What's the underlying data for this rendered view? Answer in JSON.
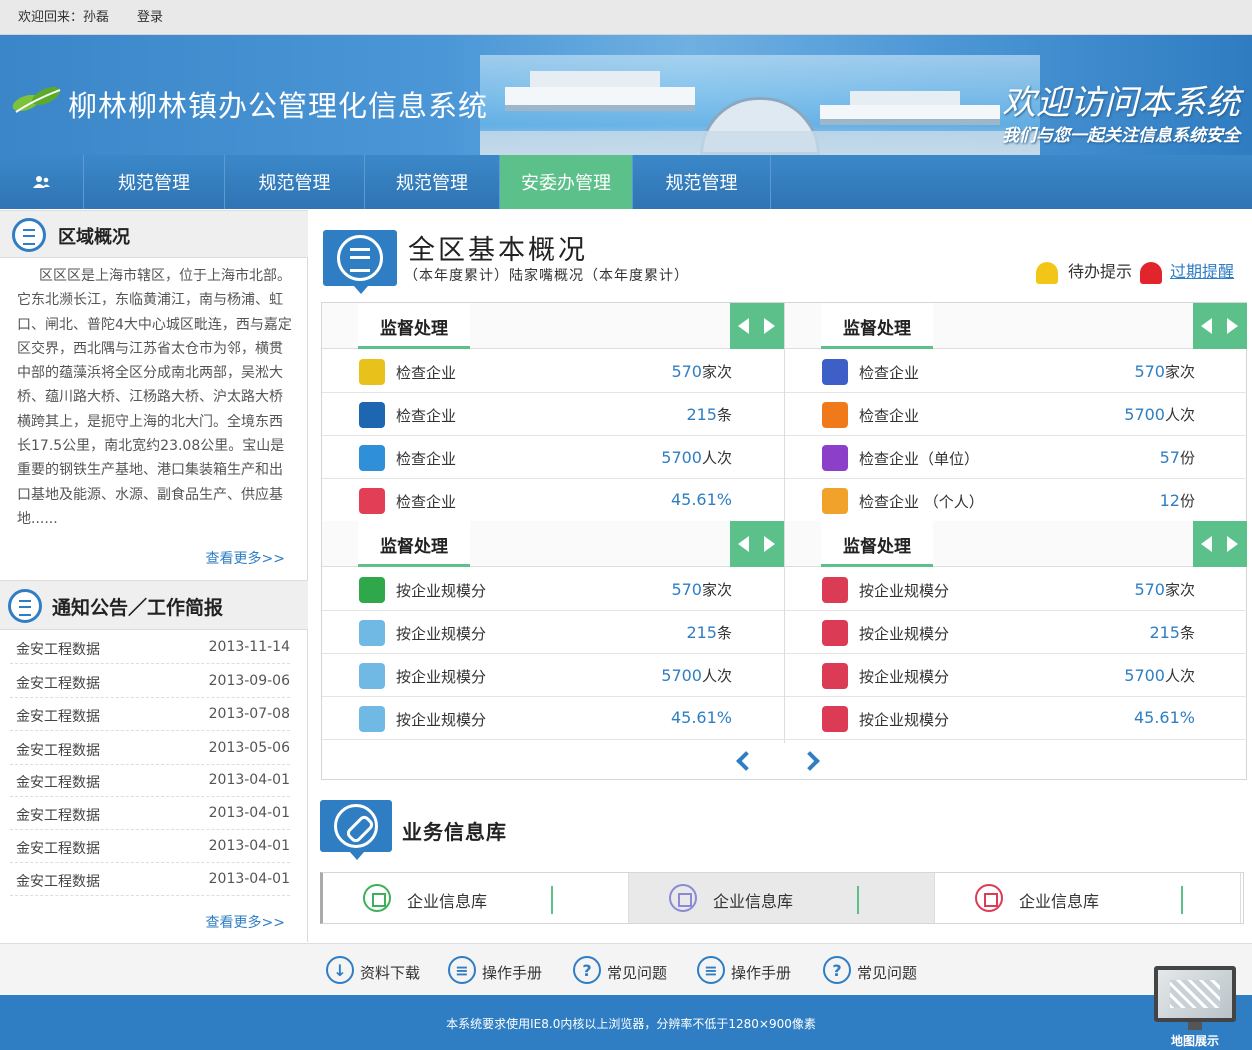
{
  "topbar": {
    "welcome": "欢迎回来：孙磊",
    "login": "登录"
  },
  "header": {
    "title": "柳林柳林镇办公管理化信息系统",
    "slogan": "欢迎访问本系统",
    "slogan_sub": "我们与您一起关注信息系统安全"
  },
  "nav": {
    "home_icon": "users-icon",
    "items": [
      {
        "label": "规范管理",
        "active": false
      },
      {
        "label": "规范管理",
        "active": false
      },
      {
        "label": "规范管理",
        "active": false
      },
      {
        "label": "安委办管理",
        "active": true
      },
      {
        "label": "规范管理",
        "active": false
      }
    ]
  },
  "area": {
    "title": "区域概况",
    "text": "区区区是上海市辖区，位于上海市北部。它东北濒长江，东临黄浦江，南与杨浦、虹口、闸北、普陀4大中心城区毗连，西与嘉定区交界，西北隅与江苏省太仓市为邻，横贯中部的蕴藻浜将全区分成南北两部，吴淞大桥、蕴川路大桥、江杨路大桥、沪太路大桥横跨其上，是扼守上海的北大门。全境东西长17.5公里，南北宽约23.08公里。宝山是重要的钢铁生产基地、港口集装箱生产和出口基地及能源、水源、副食品生产、供应基地......",
    "more": "查看更多>>"
  },
  "notice": {
    "title": "通知公告／工作简报",
    "more": "查看更多>>",
    "items": [
      {
        "name": "金安工程数据",
        "date": "2013-11-14"
      },
      {
        "name": "金安工程数据",
        "date": "2013-09-06"
      },
      {
        "name": "金安工程数据",
        "date": "2013-07-08"
      },
      {
        "name": "金安工程数据",
        "date": "2013-05-06"
      },
      {
        "name": "金安工程数据",
        "date": "2013-04-01"
      },
      {
        "name": "金安工程数据",
        "date": "2013-04-01"
      },
      {
        "name": "金安工程数据",
        "date": "2013-04-01"
      },
      {
        "name": "金安工程数据",
        "date": "2013-04-01"
      }
    ]
  },
  "main": {
    "title": "全区基本概况",
    "subtitle": "（本年度累计）陆家嘴概况（本年度累计）",
    "todo": "待办提示",
    "expire": "过期提醒"
  },
  "blocks": [
    {
      "label": "监督处理",
      "rows": [
        {
          "icon": "search-icon",
          "color": "#e8c21a",
          "name": "检查企业",
          "value": "570",
          "unit": "家次"
        },
        {
          "icon": "drop-icon",
          "color": "#1e66b0",
          "name": "检查企业",
          "value": "215",
          "unit": "条"
        },
        {
          "icon": "people-icon",
          "color": "#2f8fd8",
          "name": "检查企业",
          "value": "5700",
          "unit": "人次"
        },
        {
          "icon": "chart-icon",
          "color": "#e23e55",
          "name": "检查企业",
          "value": "45.61%",
          "unit": ""
        }
      ]
    },
    {
      "label": "监督处理",
      "rows": [
        {
          "icon": "user-icon",
          "color": "#3f5fc8",
          "name": "检查企业",
          "value": "570",
          "unit": "家次"
        },
        {
          "icon": "blogger-icon",
          "color": "#f07a1a",
          "name": "检查企业",
          "value": "5700",
          "unit": "人次"
        },
        {
          "icon": "message-icon",
          "color": "#8c3fc8",
          "name": "检查企业（单位）",
          "value": "57",
          "unit": "份"
        },
        {
          "icon": "card-icon",
          "color": "#f0a22a",
          "name": "检查企业 （个人）",
          "value": "12",
          "unit": "份"
        }
      ]
    },
    {
      "label": "监督处理",
      "rows": [
        {
          "icon": "xbox-icon",
          "color": "#2ea84a",
          "name": "按企业规模分",
          "value": "570",
          "unit": "家次"
        },
        {
          "icon": "globe-icon",
          "color": "#6fb9e4",
          "name": "按企业规模分",
          "value": "215",
          "unit": "条"
        },
        {
          "icon": "globe-icon",
          "color": "#6fb9e4",
          "name": "按企业规模分",
          "value": "5700",
          "unit": "人次"
        },
        {
          "icon": "globe-icon",
          "color": "#6fb9e4",
          "name": "按企业规模分",
          "value": "45.61%",
          "unit": ""
        }
      ]
    },
    {
      "label": "监督处理",
      "rows": [
        {
          "icon": "calendar-icon",
          "color": "#dc3b55",
          "name": "按企业规模分",
          "value": "570",
          "unit": "家次"
        },
        {
          "icon": "calendar-icon",
          "color": "#dc3b55",
          "name": "按企业规模分",
          "value": "215",
          "unit": "条"
        },
        {
          "icon": "calendar-icon",
          "color": "#dc3b55",
          "name": "按企业规模分",
          "value": "5700",
          "unit": "人次"
        },
        {
          "icon": "calendar-icon",
          "color": "#dc3b55",
          "name": "按企业规模分",
          "value": "45.61%",
          "unit": ""
        }
      ]
    }
  ],
  "biz": {
    "title": "业务信息库",
    "items": [
      {
        "label": "企业信息库",
        "icon": "list-icon",
        "color": "#3fb05a"
      },
      {
        "label": "企业信息库",
        "icon": "list-icon",
        "color": "#8a8ad6"
      },
      {
        "label": "企业信息库",
        "icon": "user-icon",
        "color": "#dc3b55"
      }
    ]
  },
  "links": [
    {
      "label": "资料下载",
      "icon": "download-icon"
    },
    {
      "label": "操作手册",
      "icon": "document-icon"
    },
    {
      "label": "常见问题",
      "icon": "question-icon"
    },
    {
      "label": "操作手册",
      "icon": "document-icon"
    },
    {
      "label": "常见问题",
      "icon": "question-icon"
    }
  ],
  "footer": {
    "text": "本系统要求使用IE8.0内核以上浏览器，分辨率不低于1280×900像素",
    "map": "地图展示"
  }
}
